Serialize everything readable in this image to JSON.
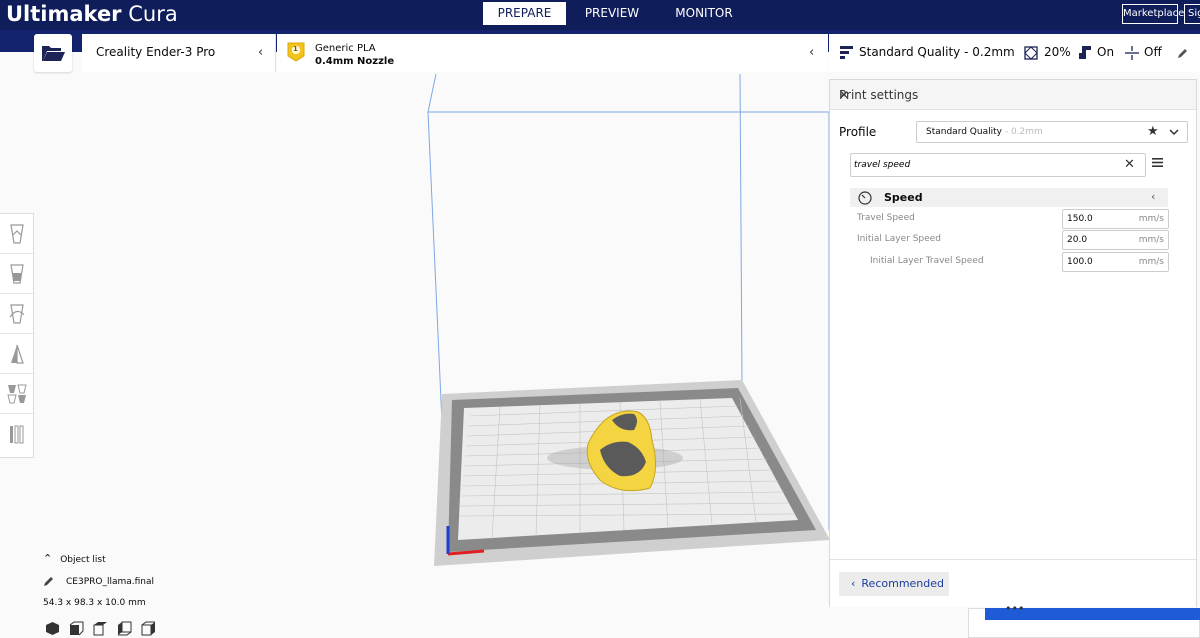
{
  "app": {
    "name_bold": "Ultimaker",
    "name_light": " Cura"
  },
  "tabs": [
    {
      "label": "PREPARE",
      "active": true
    },
    {
      "label": "PREVIEW",
      "active": false
    },
    {
      "label": "MONITOR",
      "active": false
    }
  ],
  "header_buttons": {
    "marketplace": "Marketplace",
    "signin": "Sign in"
  },
  "printer": {
    "name": "Creality Ender-3 Pro"
  },
  "material": {
    "extruder_number": "1",
    "name": "Generic PLA",
    "nozzle": "0.4mm Nozzle"
  },
  "quality_bar": {
    "profile": "Standard Quality - 0.2mm",
    "infill": "20%",
    "support": "On",
    "adhesion": "Off"
  },
  "print_settings": {
    "title": "Print settings",
    "profile_label": "Profile",
    "profile_value": "Standard Quality",
    "profile_suffix": " - 0.2mm",
    "search_value": "travel speed",
    "category": "Speed",
    "settings": [
      {
        "label": "Travel Speed",
        "value": "150.0",
        "unit": "mm/s",
        "indent": 0
      },
      {
        "label": "Initial Layer Speed",
        "value": "20.0",
        "unit": "mm/s",
        "indent": 0
      },
      {
        "label": "Initial Layer Travel Speed",
        "value": "100.0",
        "unit": "mm/s",
        "indent": 1
      }
    ],
    "recommended_label": "Recommended"
  },
  "object_list": {
    "header": "Object list",
    "object_name": "CE3PRO_llama.final",
    "dimensions": "54.3 x 98.3 x 10.0 mm"
  },
  "colors": {
    "topbar": "#0f1d5b",
    "accent_blue": "#1f5bd6",
    "model_yellow": "#f5d442",
    "badge_yellow": "#f2c31b"
  },
  "icons": {
    "open": "folder-open-icon",
    "quality": "quality-bars-icon",
    "infill": "infill-icon",
    "support": "support-icon",
    "adhesion": "adhesion-icon",
    "edit": "pencil-icon",
    "speed": "speedometer-icon",
    "favorite": "star-icon",
    "menu": "hamburger-icon"
  }
}
